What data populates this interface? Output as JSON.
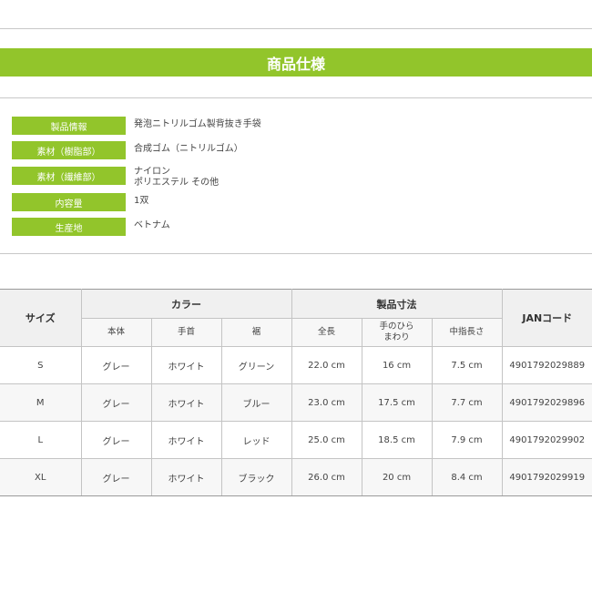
{
  "banner": {
    "title": "商品仕様"
  },
  "specs": [
    {
      "label": "製品情報",
      "value": "発泡ニトリルゴム製背抜き手袋"
    },
    {
      "label": "素材（樹脂部）",
      "value": "合成ゴム（ニトリルゴム）"
    },
    {
      "label": "素材（繊維部）",
      "value": "ナイロン\nポリエステル その他"
    },
    {
      "label": "内容量",
      "value": "1双"
    },
    {
      "label": "生産地",
      "value": "ベトナム"
    }
  ],
  "size_table": {
    "header_size": "サイズ",
    "header_color": "カラー",
    "header_dimensions": "製品寸法",
    "header_jan": "JANコード",
    "sub_headers": [
      "本体",
      "手首",
      "裾",
      "全長",
      "手のひら\nまわり",
      "中指長さ"
    ],
    "rows": [
      {
        "size": "S",
        "body": "グレー",
        "wrist": "ホワイト",
        "hem": "グリーン",
        "length": "22.0 cm",
        "palm": "16 cm",
        "middle": "7.5 cm",
        "jan": "4901792029889"
      },
      {
        "size": "M",
        "body": "グレー",
        "wrist": "ホワイト",
        "hem": "ブルー",
        "length": "23.0 cm",
        "palm": "17.5 cm",
        "middle": "7.7 cm",
        "jan": "4901792029896"
      },
      {
        "size": "L",
        "body": "グレー",
        "wrist": "ホワイト",
        "hem": "レッド",
        "length": "25.0 cm",
        "palm": "18.5 cm",
        "middle": "7.9 cm",
        "jan": "4901792029902"
      },
      {
        "size": "XL",
        "body": "グレー",
        "wrist": "ホワイト",
        "hem": "ブラック",
        "length": "26.0 cm",
        "palm": "20 cm",
        "middle": "8.4 cm",
        "jan": "4901792029919"
      }
    ]
  },
  "colors": {
    "accent": "#92c52b"
  }
}
